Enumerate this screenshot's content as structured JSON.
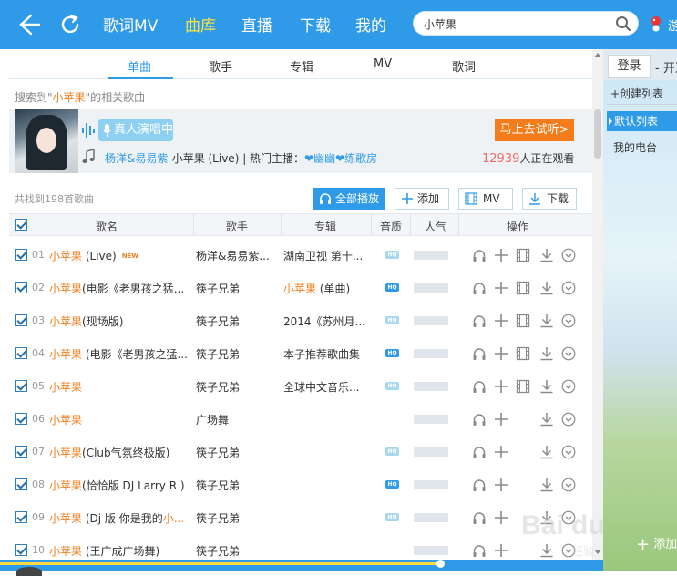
{
  "nav": {
    "items": [
      "歌词MV",
      "曲库",
      "直播",
      "下载",
      "我的"
    ],
    "active_index": 1,
    "search_value": "小苹果",
    "right_truncated": "游"
  },
  "tabs": [
    "单曲",
    "歌手",
    "专辑",
    "MV",
    "歌词"
  ],
  "active_tab": 0,
  "search_result": {
    "prefix": "搜索到\"",
    "keyword": "小苹果",
    "suffix": "\"的相关歌曲"
  },
  "banner": {
    "live_label": "真人演唱中",
    "try_label": "马上去试听>",
    "song_artist": "杨洋&易易紫",
    "song_title": "-小苹果 (Live)",
    "hot_label": "| 热门主播：",
    "anchors": "❤幽幽❤练歌房",
    "viewers": "12939",
    "viewers_suffix": "人正在观看"
  },
  "found_count": "共找到198首歌曲",
  "toolbar": {
    "play_all": "全部播放",
    "add": "添加",
    "mv": "MV",
    "download": "下载"
  },
  "columns": [
    "歌名",
    "歌手",
    "专辑",
    "音质",
    "人气",
    "操作"
  ],
  "songs": [
    {
      "num": "01",
      "kw": "小苹果",
      "rest": " (Live)",
      "new": "NEW",
      "artist": "杨洋&易易紫...",
      "album_kw": "",
      "album": "湖南卫视 第十...",
      "hq": true,
      "hq_color": "#a9d8ee",
      "ops": [
        "headphone",
        "plus",
        "film",
        "download",
        "more"
      ]
    },
    {
      "num": "02",
      "kw": "小苹果",
      "rest": "(电影《老男孩之猛...",
      "new": "",
      "artist": "筷子兄弟",
      "album_kw": "小苹果",
      "album": " (单曲)",
      "hq": true,
      "hq_color": "#2f9be8",
      "ops": [
        "headphone",
        "plus",
        "film",
        "download",
        "more"
      ]
    },
    {
      "num": "03",
      "kw": "小苹果",
      "rest": "(现场版)",
      "new": "",
      "artist": "筷子兄弟",
      "album_kw": "",
      "album": "2014《苏州月...",
      "hq": true,
      "hq_color": "#a9d8ee",
      "ops": [
        "headphone",
        "plus",
        "film",
        "download",
        "more"
      ]
    },
    {
      "num": "04",
      "kw": "小苹果",
      "rest": " (电影《老男孩之猛...",
      "new": "",
      "artist": "筷子兄弟",
      "album_kw": "",
      "album": "本子推荐歌曲集",
      "hq": true,
      "hq_color": "#2f9be8",
      "ops": [
        "headphone",
        "plus",
        "film",
        "download",
        "more"
      ]
    },
    {
      "num": "05",
      "kw": "小苹果",
      "rest": "",
      "new": "",
      "artist": "筷子兄弟",
      "album_kw": "",
      "album": "全球中文音乐...",
      "hq": true,
      "hq_color": "#a9d8ee",
      "ops": [
        "headphone",
        "plus",
        "film",
        "download",
        "more"
      ]
    },
    {
      "num": "06",
      "kw": "小苹果",
      "rest": "",
      "new": "",
      "artist": "广场舞",
      "album_kw": "",
      "album": "",
      "hq": false,
      "hq_color": "",
      "ops": [
        "headphone",
        "plus",
        "",
        "download",
        "more"
      ]
    },
    {
      "num": "07",
      "kw": "小苹果",
      "rest": "(Club气氛终极版)",
      "new": "",
      "artist": "筷子兄弟",
      "album_kw": "",
      "album": "",
      "hq": true,
      "hq_color": "#a9d8ee",
      "ops": [
        "headphone",
        "plus",
        "",
        "download",
        "more"
      ]
    },
    {
      "num": "08",
      "kw": "小苹果",
      "rest": "(恰恰版 DJ Larry R )",
      "new": "",
      "artist": "筷子兄弟",
      "album_kw": "",
      "album": "",
      "hq": true,
      "hq_color": "#2f9be8",
      "ops": [
        "headphone",
        "plus",
        "",
        "download",
        "more"
      ]
    },
    {
      "num": "09",
      "kw": "小苹果",
      "rest": " (Dj 版 你是我的",
      "rest_kw": "小...",
      "new": "",
      "artist": "筷子兄弟",
      "album_kw": "",
      "album": "",
      "hq": true,
      "hq_color": "#a9d8ee",
      "ops": [
        "headphone",
        "plus",
        "",
        "download",
        "more"
      ]
    },
    {
      "num": "10",
      "kw": "小苹果",
      "rest": " (王广成广场舞)",
      "new": "",
      "artist": "筷子兄弟",
      "album_kw": "",
      "album": "",
      "hq": false,
      "hq_color": "",
      "ops": [
        "headphone",
        "plus",
        "",
        "download",
        "more"
      ]
    }
  ],
  "sidebar": {
    "login": "登录",
    "open": "- 开通",
    "create": "+创建列表",
    "default_list": "默认列表",
    "my_radio": "我的电台",
    "add": "添加"
  },
  "watermark": {
    "brand": "Bai du",
    "sub": "经验"
  },
  "colors": {
    "accent": "#2f9be8",
    "keyword": "#f07f1e",
    "try_button": "#f47c1b",
    "active_nav": "#ffe43f"
  }
}
